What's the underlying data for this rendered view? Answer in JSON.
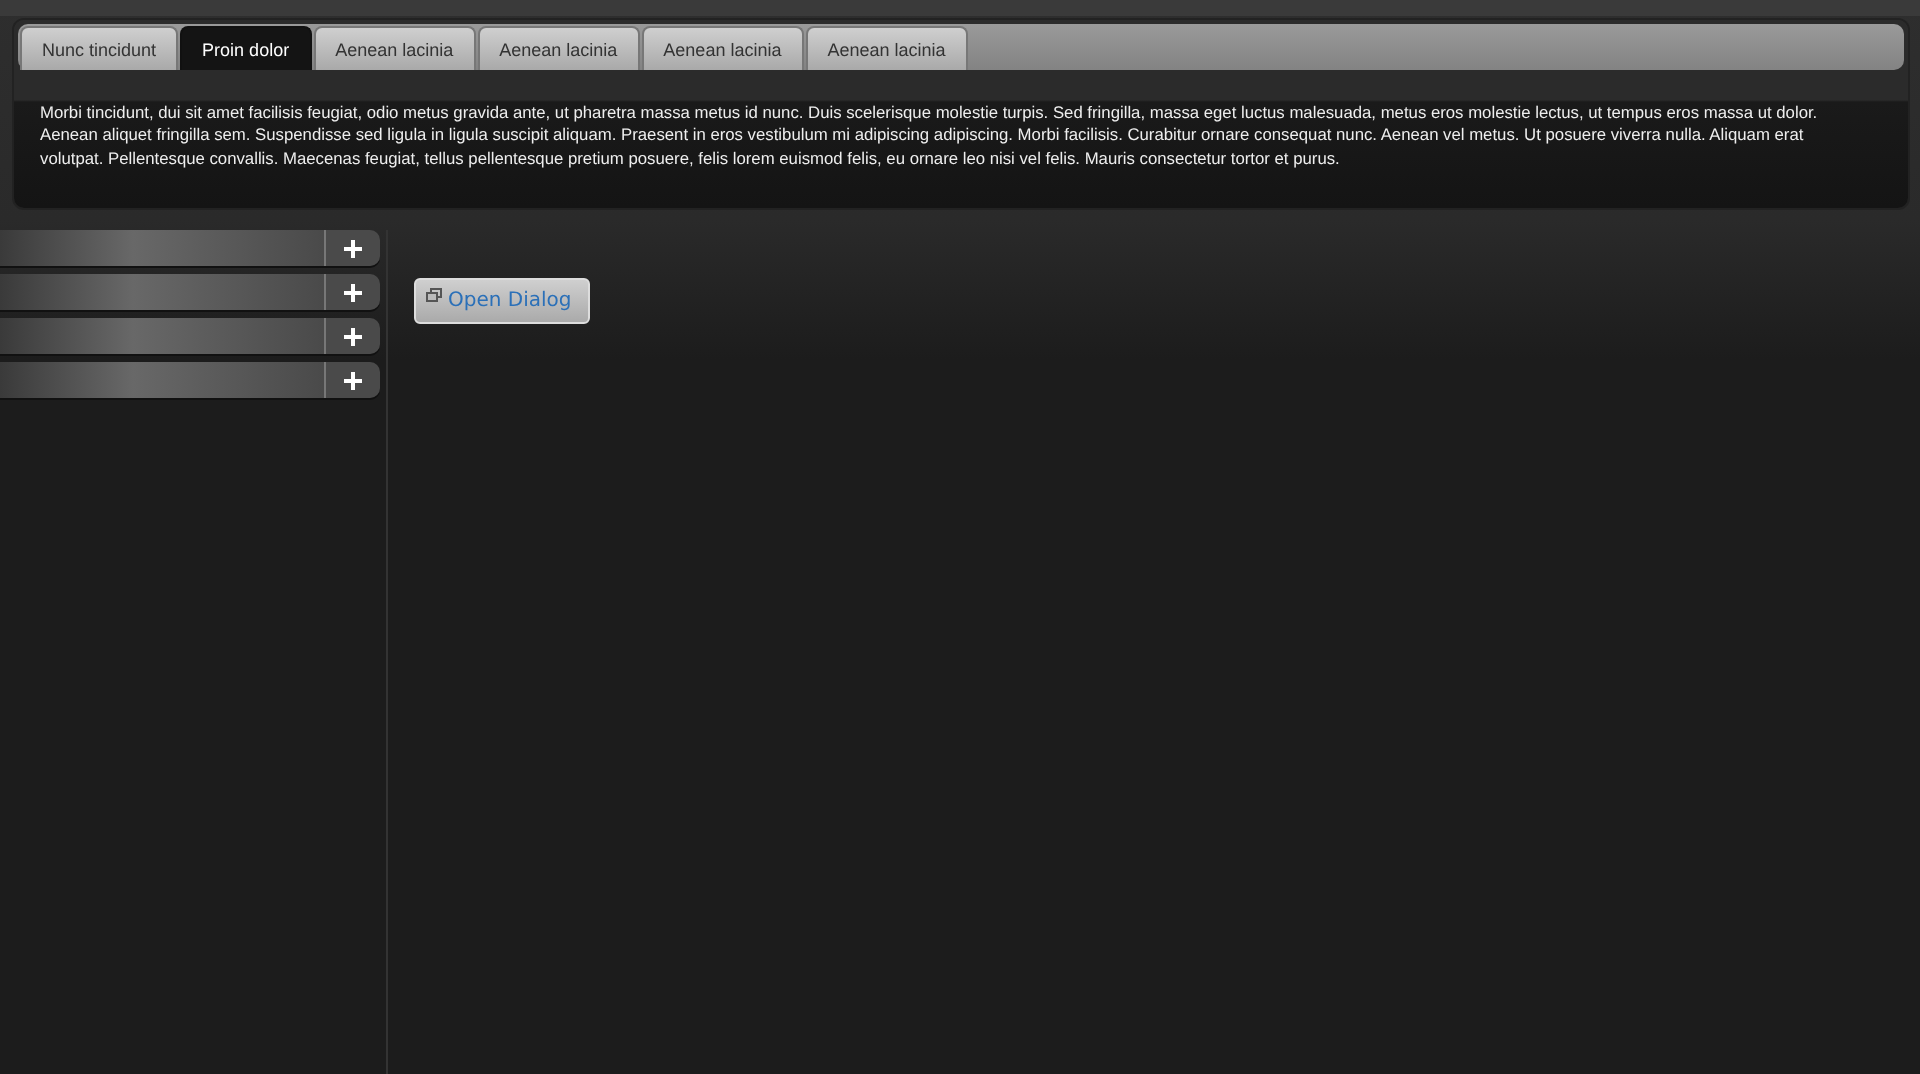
{
  "tabs": [
    {
      "label": "Nunc tincidunt",
      "selected": false
    },
    {
      "label": "Proin dolor",
      "selected": true
    },
    {
      "label": "Aenean lacinia",
      "selected": false
    },
    {
      "label": "Aenean lacinia",
      "selected": false
    },
    {
      "label": "Aenean lacinia",
      "selected": false
    },
    {
      "label": "Aenean lacinia",
      "selected": false
    }
  ],
  "tab_content": "Morbi tincidunt, dui sit amet facilisis feugiat, odio metus gravida ante, ut pharetra massa metus id nunc. Duis scelerisque molestie turpis. Sed fringilla, massa eget luctus malesuada, metus eros molestie lectus, ut tempus eros massa ut dolor. Aenean aliquet fringilla sem. Suspendisse sed ligula in ligula suscipit aliquam. Praesent in eros vestibulum mi adipiscing adipiscing. Morbi facilisis. Curabitur ornare consequat nunc. Aenean vel metus. Ut posuere viverra nulla. Aliquam erat volutpat. Pellentesque convallis. Maecenas feugiat, tellus pellentesque pretium posuere, felis lorem euismod felis, eu ornare leo nisi vel felis. Mauris consectetur tortor et purus.",
  "accordion": [
    {
      "expanded": false
    },
    {
      "expanded": false
    },
    {
      "expanded": false
    },
    {
      "expanded": false
    }
  ],
  "dialog_button": {
    "label": "Open Dialog"
  }
}
